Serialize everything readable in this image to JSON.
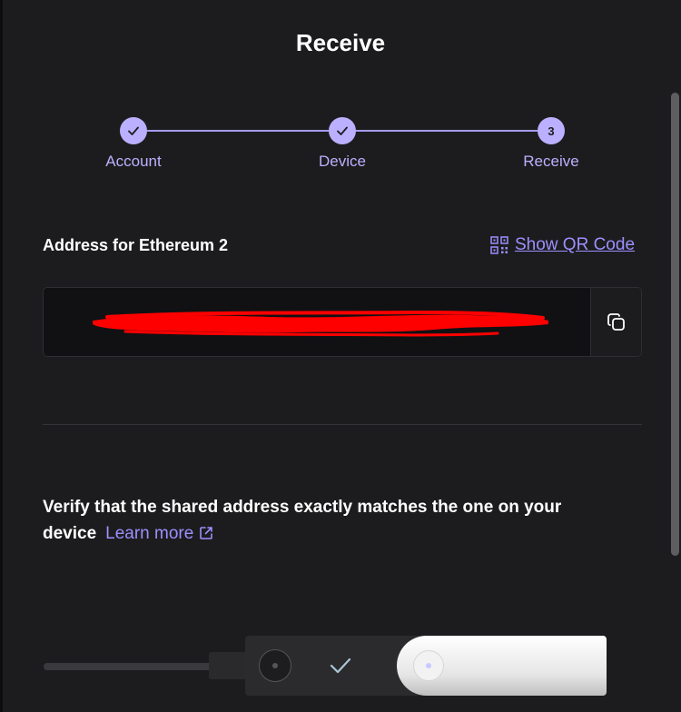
{
  "title": "Receive",
  "stepper": {
    "steps": [
      {
        "label": "Account",
        "state": "done"
      },
      {
        "label": "Device",
        "state": "done"
      },
      {
        "label": "Receive",
        "state": "current",
        "number": "3"
      }
    ]
  },
  "address": {
    "label": "Address for Ethereum 2",
    "qr_link": "Show QR Code",
    "value": "",
    "redacted": true
  },
  "verify": {
    "text": "Verify that the shared address exactly matches the one on your device",
    "learn_more": "Learn more"
  },
  "colors": {
    "background": "#1c1c1e",
    "accent": "#bbb0ff",
    "link": "#9d8fff",
    "redaction": "#ff0000"
  },
  "icons": [
    "check-icon",
    "qr-code-icon",
    "copy-icon",
    "external-link-icon"
  ]
}
